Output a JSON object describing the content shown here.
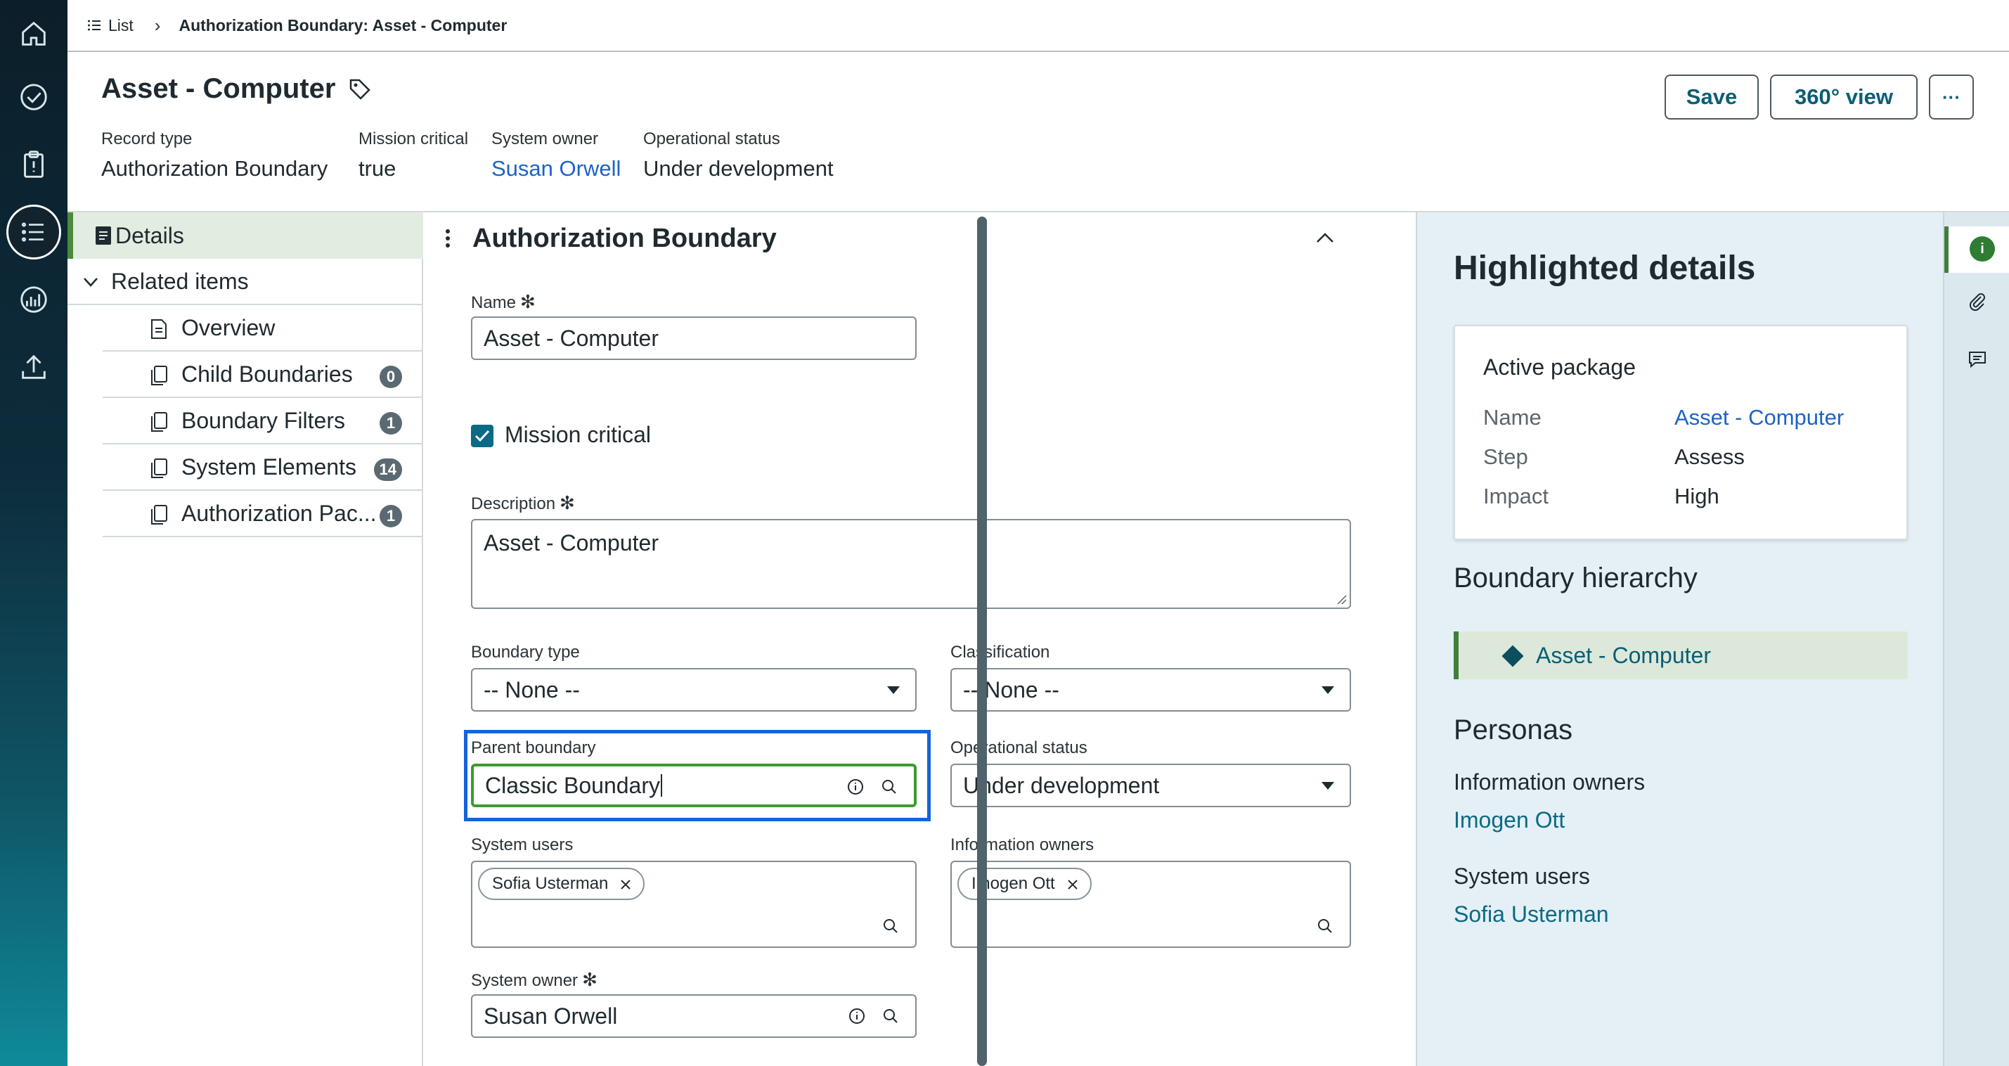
{
  "breadcrumb": {
    "list_label": "List",
    "current": "Authorization Boundary: Asset - Computer"
  },
  "record": {
    "title": "Asset - Computer",
    "meta": [
      {
        "label": "Record type",
        "value": "Authorization Boundary"
      },
      {
        "label": "Mission critical",
        "value": "true"
      },
      {
        "label": "System owner",
        "value": "Susan Orwell"
      },
      {
        "label": "Operational status",
        "value": "Under development"
      }
    ],
    "save_label": "Save",
    "view_label": "360° view",
    "more_label": "···"
  },
  "nav": {
    "details": "Details",
    "related": "Related items",
    "items": [
      {
        "label": "Overview",
        "count": ""
      },
      {
        "label": "Child Boundaries",
        "count": "0"
      },
      {
        "label": "Boundary Filters",
        "count": "1"
      },
      {
        "label": "System Elements",
        "count": "14"
      },
      {
        "label": "Authorization Pac...",
        "count": "1"
      }
    ]
  },
  "form": {
    "section_title": "Authorization Boundary",
    "name_label": "Name",
    "name_value": "Asset - Computer",
    "required_mark": "✻",
    "mission_label": "Mission critical",
    "description_label": "Description",
    "description_value": "Asset - Computer",
    "boundary_type_label": "Boundary type",
    "boundary_type_value": "-- None --",
    "classification_label": "Classification",
    "classification_value": "-- None --",
    "parent_label": "Parent boundary",
    "parent_value": "Classic Boundary",
    "opstatus_label": "Operational status",
    "opstatus_value": "Under development",
    "system_users_label": "System users",
    "system_users_chip": "Sofia Usterman",
    "info_owners_label": "Information owners",
    "info_owners_chip": "Imogen Ott",
    "system_owner_label": "System owner",
    "system_owner_value": "Susan Orwell"
  },
  "highlights": {
    "title": "Highlighted details",
    "package_head": "Active package",
    "rows": [
      {
        "k": "Name",
        "v": "Asset - Computer"
      },
      {
        "k": "Step",
        "v": "Assess"
      },
      {
        "k": "Impact",
        "v": "High"
      }
    ],
    "hierarchy_title": "Boundary hierarchy",
    "hierarchy_item": "Asset - Computer",
    "personas_title": "Personas",
    "info_owners_label": "Information owners",
    "info_owner": "Imogen Ott",
    "system_users_label": "System users",
    "system_user": "Sofia Usterman",
    "info_dot": "i"
  },
  "colors": {
    "accent": "#0b6a85",
    "link": "#1c63c6",
    "focus": "#1662d9",
    "active_green": "#3f7f3a"
  }
}
